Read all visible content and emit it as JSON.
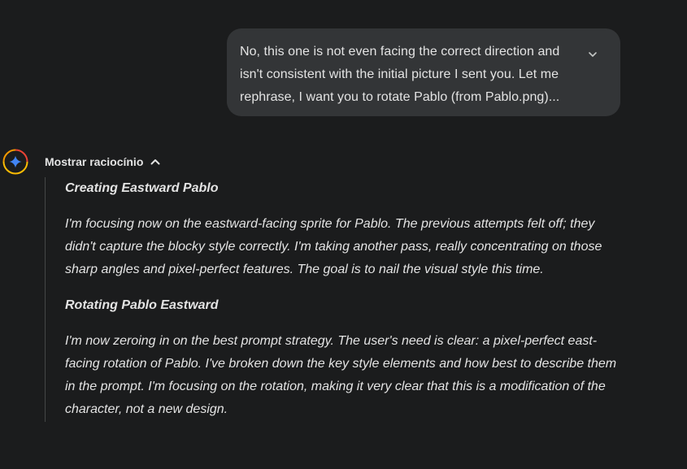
{
  "user_message": {
    "text": "No, this one is not even facing the correct direction and isn't consistent with the initial picture I sent you. Let me rephrase, I want you to rotate Pablo (from Pablo.png)...",
    "expand_icon": "chevron-down-icon"
  },
  "assistant": {
    "avatar_icon": "gemini-spark-icon",
    "reasoning_toggle_label": "Mostrar raciocínio",
    "reasoning_toggle_icon": "chevron-up-icon",
    "thoughts": [
      {
        "heading": "Creating Eastward Pablo",
        "text": "I'm focusing now on the eastward-facing sprite for Pablo.  The previous attempts felt off; they didn't capture the blocky style correctly. I'm taking another pass, really concentrating on those sharp angles and pixel-perfect features. The goal is to nail the visual style this time."
      },
      {
        "heading": "Rotating Pablo Eastward",
        "text": "I'm now zeroing in on the best prompt strategy. The user's need is clear: a pixel-perfect east-facing rotation of Pablo. I've broken down the key style elements and how best to describe them in the prompt. I'm focusing on the rotation, making it very clear that this is a modification of the character, not a new design."
      }
    ]
  },
  "colors": {
    "background": "#1b1c1d",
    "bubble": "#333537",
    "text": "#e3e3e3",
    "accent_blue": "#4285f4"
  }
}
